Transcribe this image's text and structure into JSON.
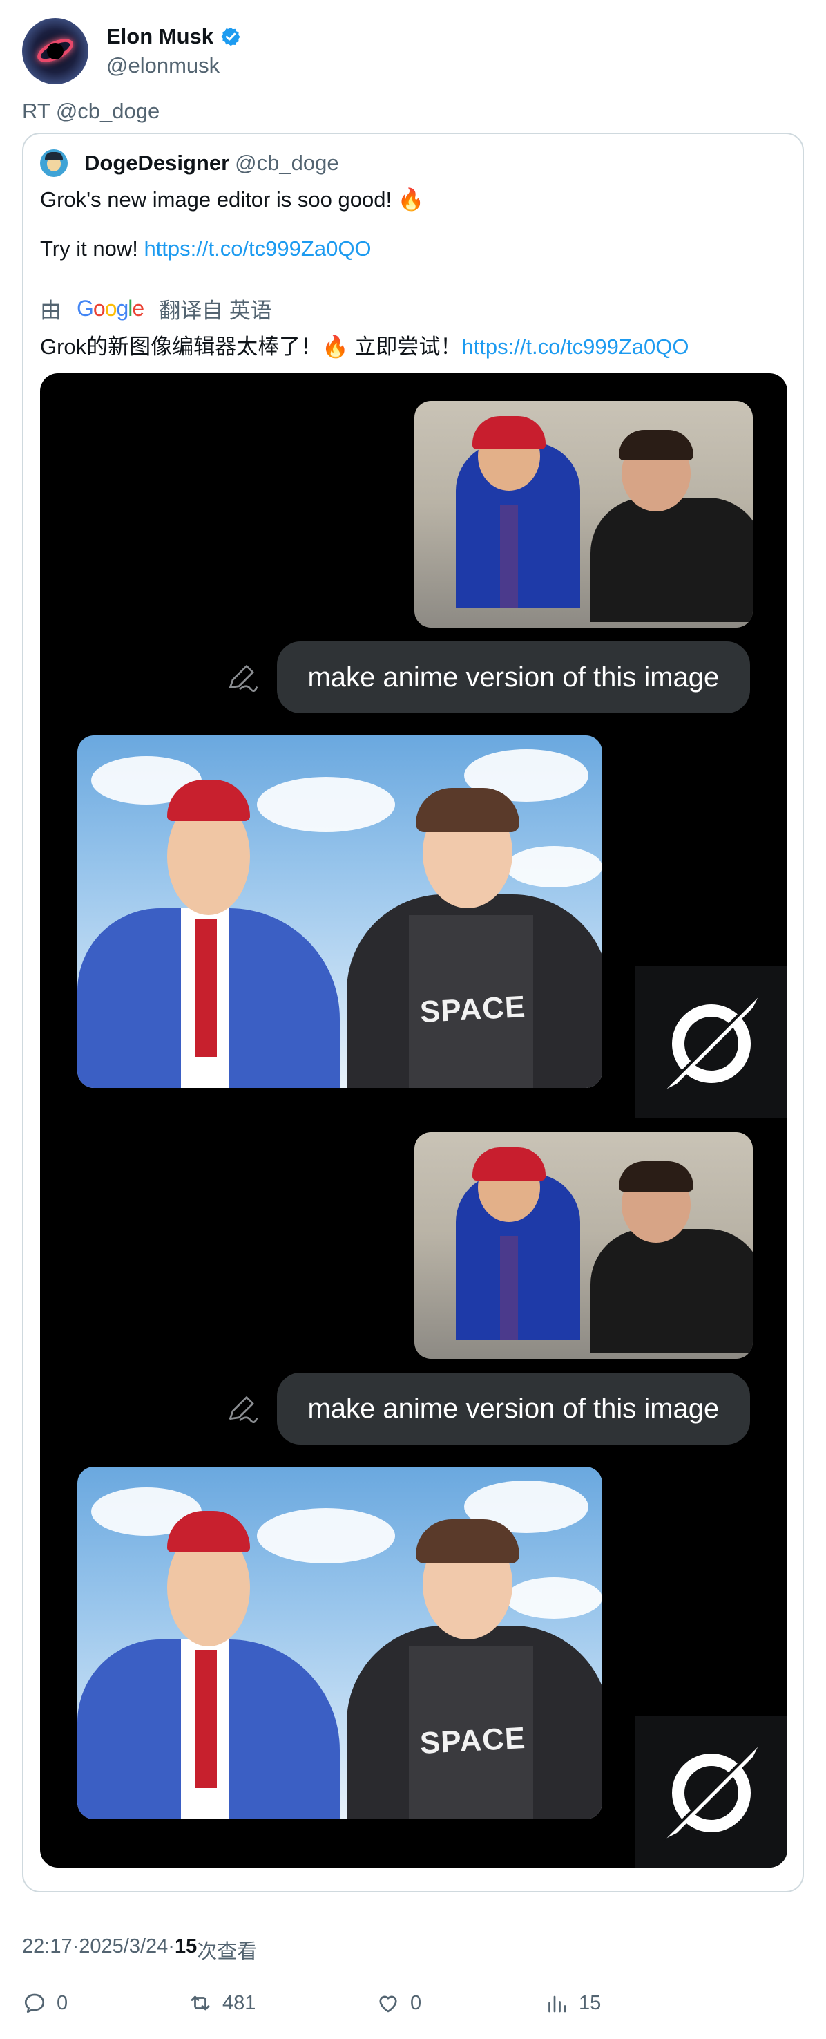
{
  "author": {
    "display_name": "Elon Musk",
    "handle": "@elonmusk",
    "verified": true,
    "avatar_icon": "black-hole-avatar"
  },
  "retweet_label": "RT @cb_doge",
  "quoted": {
    "display_name": "DogeDesigner",
    "handle": "@cb_doge",
    "text_line1": "Grok's new image editor is soo good! 🔥",
    "text_line2_prefix": "Try it now! ",
    "link": "https://t.co/tc999Za0QO",
    "translation": {
      "by_label": "由",
      "google_letters": [
        "G",
        "o",
        "o",
        "g",
        "l",
        "e"
      ],
      "from_label": "翻译自 英语",
      "text": "Grok的新图像编辑器太棒了！🔥 立即尝试！",
      "link": "https://t.co/tc999Za0QO"
    }
  },
  "conversation": [
    {
      "prompt": "make anime version of this image",
      "anime_text": "SPACE"
    },
    {
      "prompt": "make anime version of this image",
      "anime_text": "SPACE"
    }
  ],
  "meta": {
    "time": "22:17",
    "separator": " · ",
    "date": "2025/3/24",
    "views_count": "15",
    "views_label": "次查看"
  },
  "actions": {
    "replies": "0",
    "retweets": "481",
    "likes": "0",
    "views": "15"
  },
  "colors": {
    "link": "#1d9bf0",
    "muted": "#536471",
    "verified": "#1d9bf0",
    "bubble": "#2f3336"
  }
}
